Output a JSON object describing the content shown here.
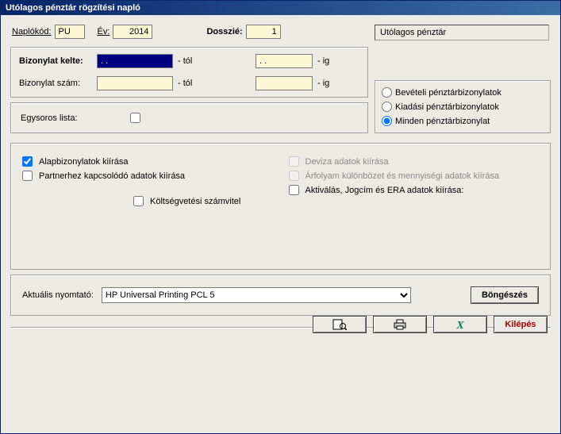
{
  "window_title": "Utólagos pénztár rögzítési napló",
  "header": {
    "naplokod_label": "Naplókód:",
    "naplokod_value": "PU",
    "ev_label": "Év:",
    "ev_value": "2014",
    "dosszie_label": "Dosszié:",
    "dosszie_value": "1",
    "readonly_title": "Utólagos pénztár"
  },
  "dates": {
    "kelte_label": "Bizonylat kelte:",
    "kelte_from": ". .",
    "kelte_to": ". .",
    "from_suffix": "- tól",
    "to_suffix": "- ig",
    "szam_label": "Bizonylat szám:",
    "szam_from": "",
    "szam_to": ""
  },
  "oneline": {
    "label": "Egysoros lista:",
    "checked": false
  },
  "radio": {
    "beveteli": "Bevételi pénztárbizonylatok",
    "kiadasi": "Kiadási pénztárbizonylatok",
    "minden": "Minden pénztárbizonylat",
    "selected": "minden"
  },
  "options": {
    "alapbiz": "Alapbizonylatok kiírása",
    "partner": "Partnerhez kapcsolódó adatok kiírása",
    "koltseg": "Költségvetési számvitel",
    "deviza": "Deviza adatok kiírása",
    "arfolyam": "Árfolyam különbözet és mennyiségi adatok kiírása",
    "aktivalas": "Aktiválás, Jogcím és ERA adatok kiírása:"
  },
  "printer": {
    "label": "Aktuális nyomtató:",
    "value": "HP Universal Printing PCL 5",
    "browse": "Böngészés"
  },
  "buttons": {
    "exit": "Kilépés"
  }
}
